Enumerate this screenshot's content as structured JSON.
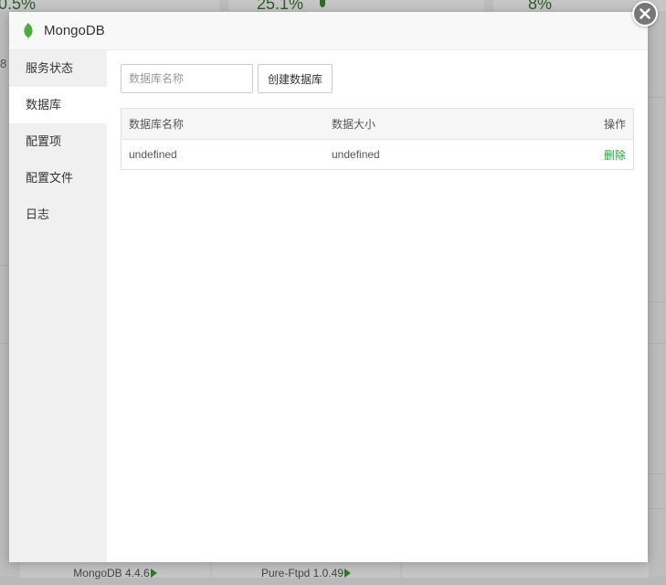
{
  "background": {
    "stats": [
      "0.5%",
      "25.1%",
      "8%"
    ],
    "side_number": "8",
    "footer_items": [
      "MongoDB 4.4.6",
      "Pure-Ftpd 1.0.49"
    ]
  },
  "modal": {
    "title": "MongoDB",
    "close_icon": "close-icon",
    "accent_color": "#20a53a"
  },
  "sidebar": {
    "items": [
      {
        "label": "服务状态"
      },
      {
        "label": "数据库"
      },
      {
        "label": "配置项"
      },
      {
        "label": "配置文件"
      },
      {
        "label": "日志"
      }
    ],
    "active_index": 1
  },
  "toolbar": {
    "db_name_placeholder": "数据库名称",
    "create_label": "创建数据库"
  },
  "table": {
    "headers": {
      "name": "数据库名称",
      "size": "数据大小",
      "action": "操作"
    },
    "rows": [
      {
        "name": "undefined",
        "size": "undefined",
        "action": "删除"
      }
    ]
  }
}
